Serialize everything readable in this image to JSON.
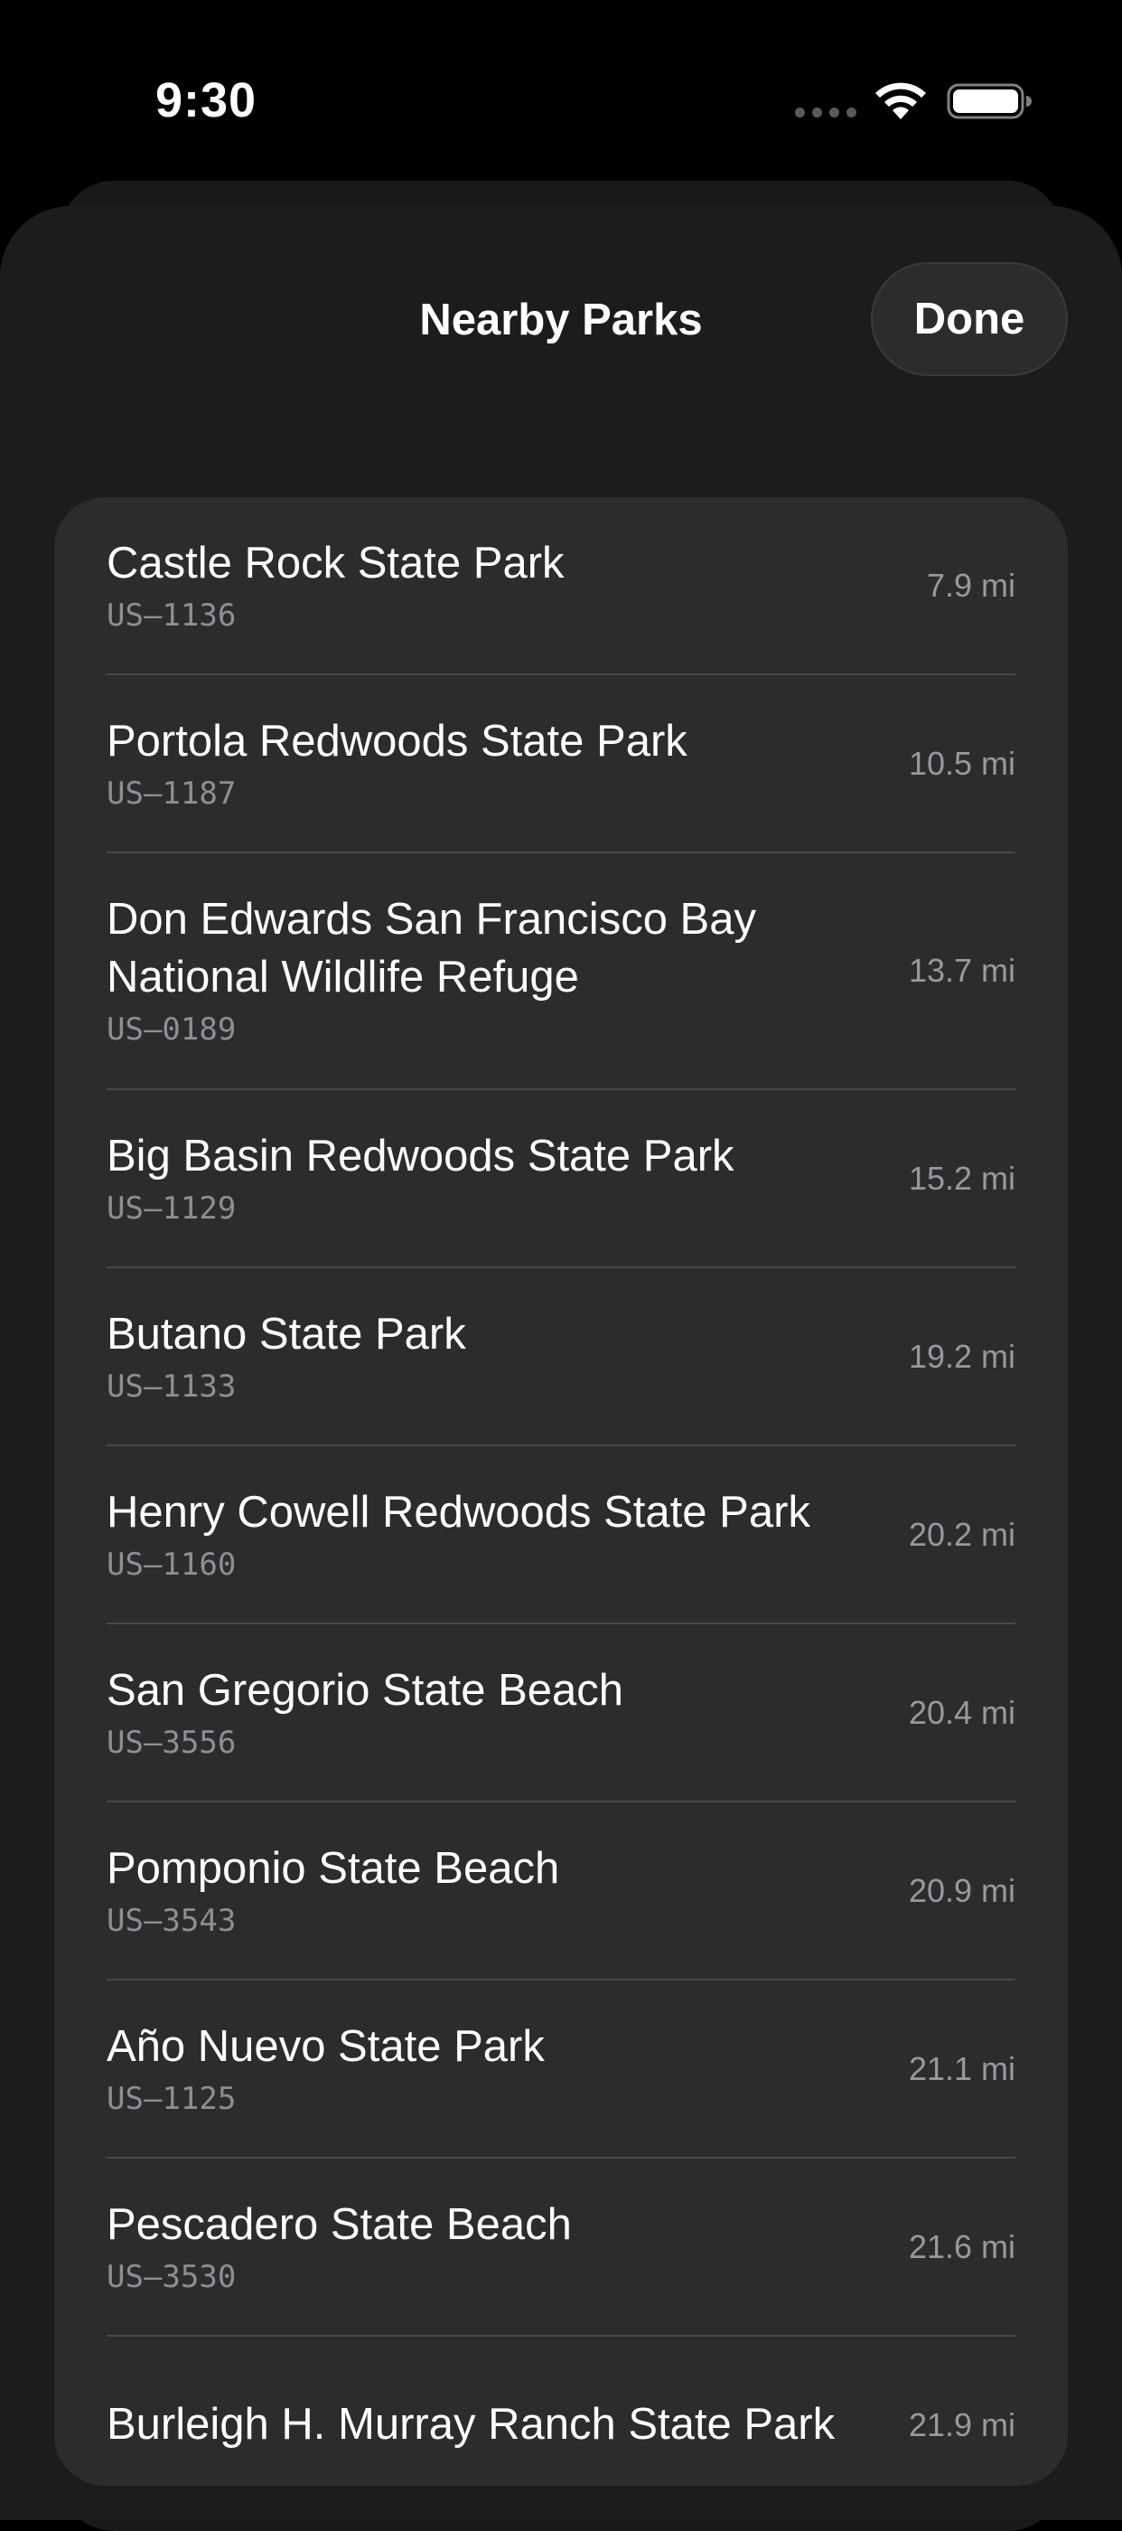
{
  "status_bar": {
    "time": "9:30"
  },
  "sheet": {
    "title": "Nearby Parks",
    "done_label": "Done"
  },
  "parks": [
    {
      "name": "Castle Rock State Park",
      "code": "US–1136",
      "distance": "7.9 mi"
    },
    {
      "name": "Portola Redwoods State Park",
      "code": "US–1187",
      "distance": "10.5 mi"
    },
    {
      "name": "Don Edwards San Francisco Bay National Wildlife Refuge",
      "code": "US–0189",
      "distance": "13.7 mi"
    },
    {
      "name": "Big Basin Redwoods State Park",
      "code": "US–1129",
      "distance": "15.2 mi"
    },
    {
      "name": "Butano State Park",
      "code": "US–1133",
      "distance": "19.2 mi"
    },
    {
      "name": "Henry Cowell Redwoods State Park",
      "code": "US–1160",
      "distance": "20.2 mi"
    },
    {
      "name": "San Gregorio State Beach",
      "code": "US–3556",
      "distance": "20.4 mi"
    },
    {
      "name": "Pomponio State Beach",
      "code": "US–3543",
      "distance": "20.9 mi"
    },
    {
      "name": "Año Nuevo State Park",
      "code": "US–1125",
      "distance": "21.1 mi"
    },
    {
      "name": "Pescadero State Beach",
      "code": "US–3530",
      "distance": "21.6 mi"
    },
    {
      "name": "Burleigh H. Murray Ranch State Park",
      "code": "",
      "distance": "21.9 mi"
    }
  ]
}
